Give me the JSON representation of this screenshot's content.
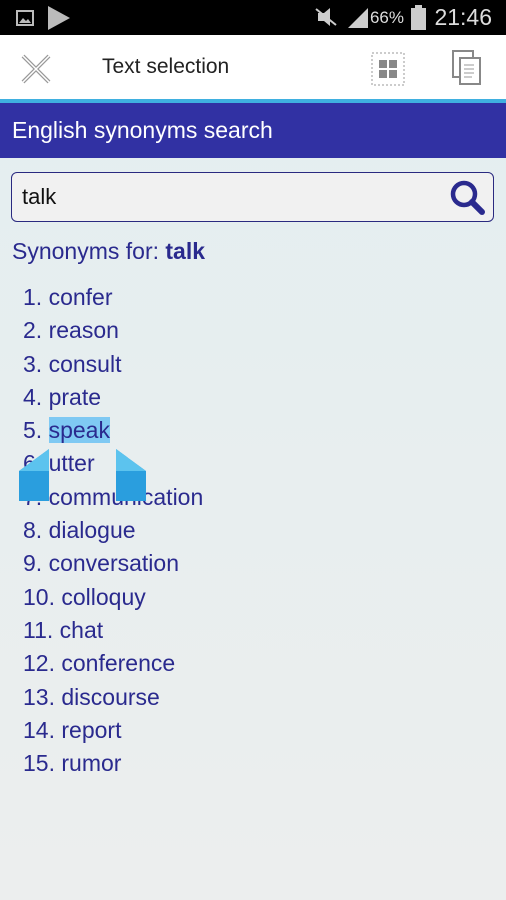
{
  "status_bar": {
    "battery": "66%",
    "time": "21:46",
    "icons": [
      "image-icon",
      "play-store-icon",
      "mute-icon",
      "signal-icon",
      "battery-icon"
    ]
  },
  "action_bar": {
    "title": "Text selection",
    "icons": [
      "close-icon",
      "select-all-icon",
      "copy-icon"
    ]
  },
  "app_header": {
    "title": "English synonyms search"
  },
  "search": {
    "value": "talk",
    "placeholder": ""
  },
  "synonyms_label": "Synonyms for:",
  "query": "talk",
  "colors": {
    "header": "#3131a3",
    "text": "#2a2a8e",
    "selection": "#7fc9f3",
    "handle": "#2a9ede"
  },
  "items": [
    {
      "num": "1.",
      "word": "confer"
    },
    {
      "num": "2.",
      "word": "reason"
    },
    {
      "num": "3.",
      "word": "consult"
    },
    {
      "num": "4.",
      "word": "prate"
    },
    {
      "num": "5.",
      "word": "speak",
      "selected": true
    },
    {
      "num": "6.",
      "word": "utter"
    },
    {
      "num": "7.",
      "word": "communication"
    },
    {
      "num": "8.",
      "word": "dialogue"
    },
    {
      "num": "9.",
      "word": "conversation"
    },
    {
      "num": "10.",
      "word": "colloquy"
    },
    {
      "num": "11.",
      "word": "chat"
    },
    {
      "num": "12.",
      "word": "conference"
    },
    {
      "num": "13.",
      "word": "discourse"
    },
    {
      "num": "14.",
      "word": "report"
    },
    {
      "num": "15.",
      "word": "rumor"
    }
  ]
}
